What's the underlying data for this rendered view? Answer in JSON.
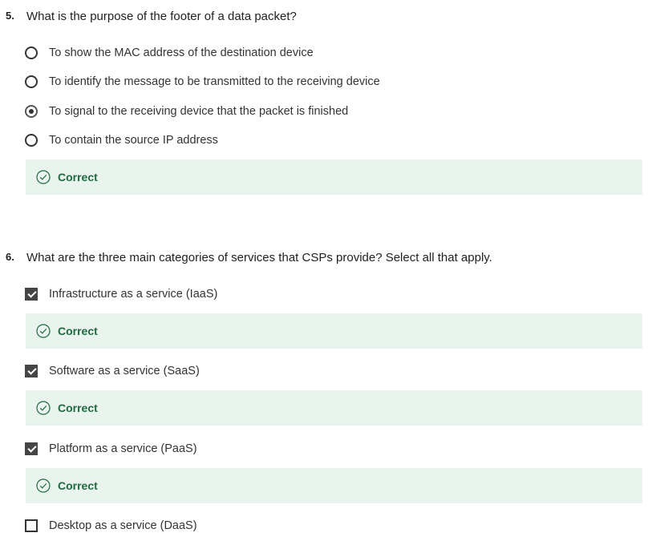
{
  "colors": {
    "correct_bg": "#eaf4ee",
    "correct_text": "#1d6b3d",
    "control": "#333333"
  },
  "q5": {
    "number": "5.",
    "text": "What is the purpose of the footer of a data packet?",
    "options": [
      {
        "label": "To show the MAC address of the destination device",
        "selected": false
      },
      {
        "label": "To identify the message to be transmitted to the receiving device",
        "selected": false
      },
      {
        "label": "To signal to the receiving device that the packet is finished",
        "selected": true
      },
      {
        "label": "To contain the source IP address",
        "selected": false
      }
    ],
    "feedback": "Correct"
  },
  "q6": {
    "number": "6.",
    "text": "What are the three main categories of services that CSPs provide? Select all that apply.",
    "options": [
      {
        "label": "Infrastructure as a service (IaaS)",
        "checked": true,
        "feedback": "Correct"
      },
      {
        "label": "Software as a service (SaaS)",
        "checked": true,
        "feedback": "Correct"
      },
      {
        "label": "Platform as a service (PaaS)",
        "checked": true,
        "feedback": "Correct"
      },
      {
        "label": "Desktop as a service (DaaS)",
        "checked": false
      }
    ]
  }
}
